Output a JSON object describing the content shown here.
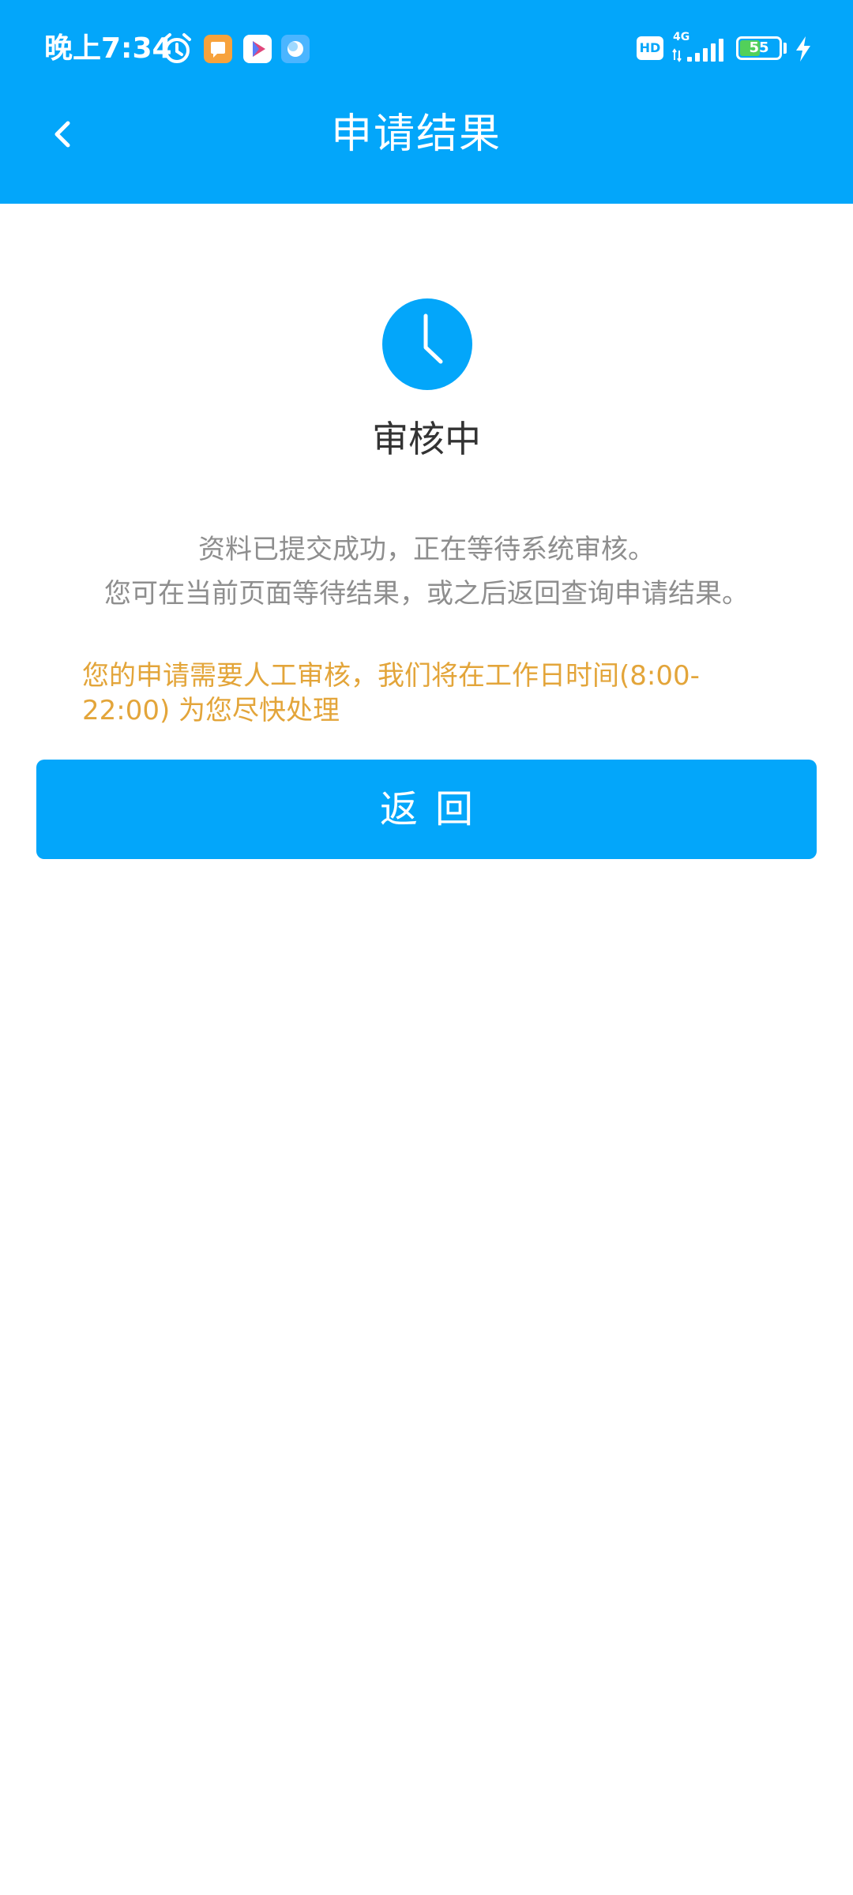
{
  "status_bar": {
    "time": "晚上7:34",
    "hd_badge": "HD",
    "network": "4G",
    "battery": "55",
    "battery_level": 0.55,
    "icons": [
      "alarm-icon",
      "message-app-icon",
      "video-app-icon",
      "chat-app-icon",
      "signal-icon",
      "battery-icon",
      "charging-icon"
    ]
  },
  "header": {
    "title": "申请结果",
    "back_icon": "chevron-left-icon"
  },
  "result": {
    "icon": "clock-icon",
    "status": "审核中",
    "description": [
      "资料已提交成功，正在等待系统审核。",
      "您可在当前页面等待结果，或之后返回查询申请结果。"
    ],
    "notice": "您的申请需要人工审核，我们将在工作日时间(8:00-22:00) 为您尽快处理"
  },
  "actions": {
    "return_label": "返回"
  },
  "colors": {
    "primary": "#03a6fa",
    "notice": "#e3a53a",
    "title_text": "#333333",
    "secondary_text": "#8e8e8e"
  }
}
